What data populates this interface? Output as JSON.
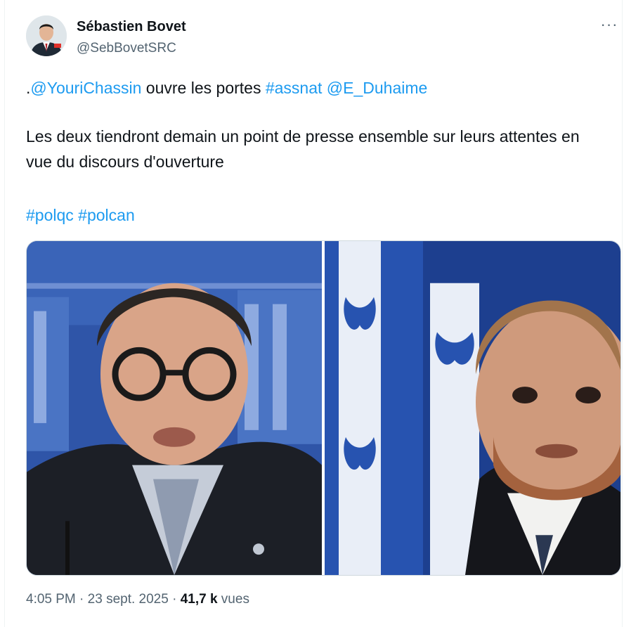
{
  "author": {
    "name": "Sébastien Bovet",
    "handle": "@SebBovetSRC",
    "avatar_icon": "profile-photo"
  },
  "more_label": "···",
  "tweet": {
    "line1": {
      "prefix": ".",
      "mention1": "@YouriChassin",
      "text": " ouvre les portes ",
      "hashtag": "#assnat",
      "space": " ",
      "mention2": "@E_Duhaime"
    },
    "line2": "Les deux tiendront demain un point de presse ensemble  sur leurs attentes en vue du discours d'ouverture",
    "line3": {
      "hashtag1": "#polqc",
      "space": " ",
      "hashtag2": "#polcan"
    }
  },
  "media": [
    {
      "name": "photo-left",
      "description_icon": "portrait-photo"
    },
    {
      "name": "photo-right",
      "description_icon": "portrait-photo"
    }
  ],
  "meta": {
    "time": "4:05 PM",
    "sep1": " · ",
    "date": "23 sept. 2025",
    "sep2": " · ",
    "views_count": "41,7 k",
    "views_label": " vues"
  },
  "colors": {
    "link": "#1d9bf0",
    "text": "#0f1419",
    "secondary": "#536471"
  }
}
